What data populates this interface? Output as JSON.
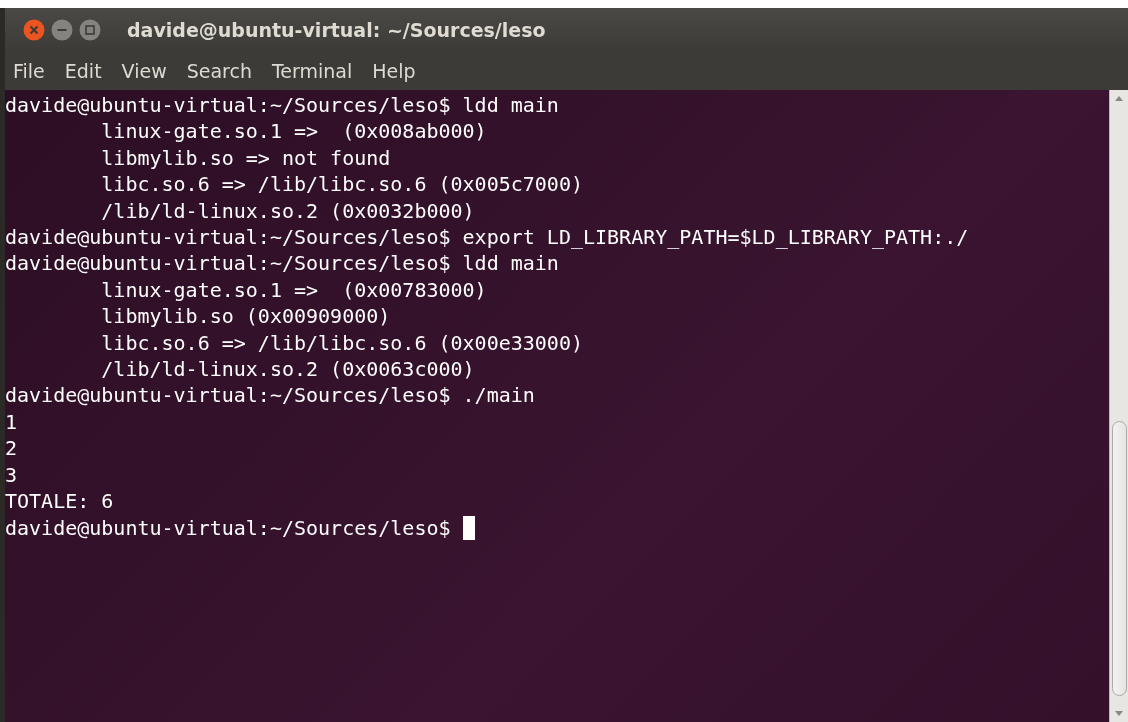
{
  "window": {
    "title": "davide@ubuntu-virtual: ~/Sources/leso"
  },
  "menu": [
    "File",
    "Edit",
    "View",
    "Search",
    "Terminal",
    "Help"
  ],
  "terminal": {
    "lines": [
      "davide@ubuntu-virtual:~/Sources/leso$ ldd main",
      "\tlinux-gate.so.1 =>  (0x008ab000)",
      "\tlibmylib.so => not found",
      "\tlibc.so.6 => /lib/libc.so.6 (0x005c7000)",
      "\t/lib/ld-linux.so.2 (0x0032b000)",
      "davide@ubuntu-virtual:~/Sources/leso$ export LD_LIBRARY_PATH=$LD_LIBRARY_PATH:./",
      "davide@ubuntu-virtual:~/Sources/leso$ ldd main",
      "\tlinux-gate.so.1 =>  (0x00783000)",
      "\tlibmylib.so (0x00909000)",
      "\tlibc.so.6 => /lib/libc.so.6 (0x00e33000)",
      "\t/lib/ld-linux.so.2 (0x0063c000)",
      "davide@ubuntu-virtual:~/Sources/leso$ ./main",
      "1",
      "2",
      "3",
      "TOTALE: 6",
      "davide@ubuntu-virtual:~/Sources/leso$ "
    ],
    "cursor": true
  }
}
